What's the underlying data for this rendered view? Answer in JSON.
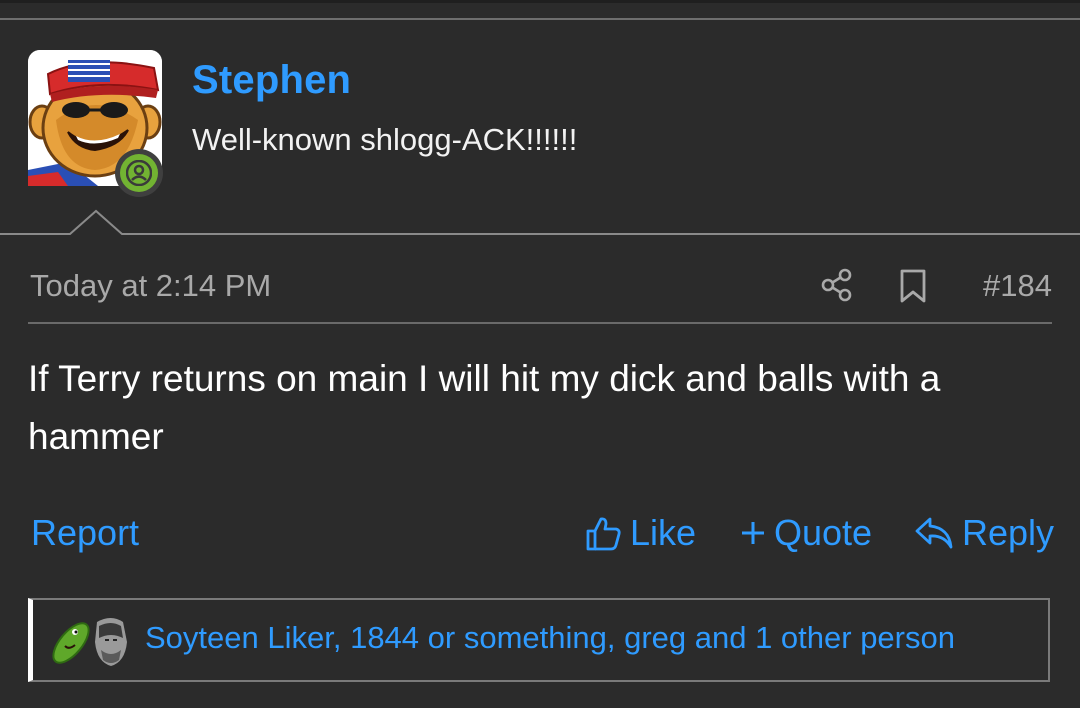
{
  "post": {
    "author": {
      "name": "Stephen",
      "user_title": "Well-known shlogg-ACK!!!!!!"
    },
    "timestamp": "Today at 2:14 PM",
    "post_number": "#184",
    "body": "If Terry returns on main I will hit my dick and balls with a hammer",
    "actions": {
      "report": "Report",
      "like": "Like",
      "quote": "Quote",
      "reply": "Reply"
    },
    "reactions_text": "Soyteen Liker, 1844 or something, greg and 1 other person"
  },
  "colors": {
    "background": "#2b2b2b",
    "link_blue": "#2f9bff",
    "muted_text": "#a9a9a9",
    "online_green": "#72b332"
  },
  "icons": {
    "online": "user-icon",
    "share": "share-icon",
    "bookmark": "bookmark-icon",
    "like": "thumbs-up-icon",
    "quote": "plus-icon",
    "reply": "reply-arrow-icon",
    "reactions": [
      "pickle-icon",
      "gigachad-icon"
    ]
  }
}
